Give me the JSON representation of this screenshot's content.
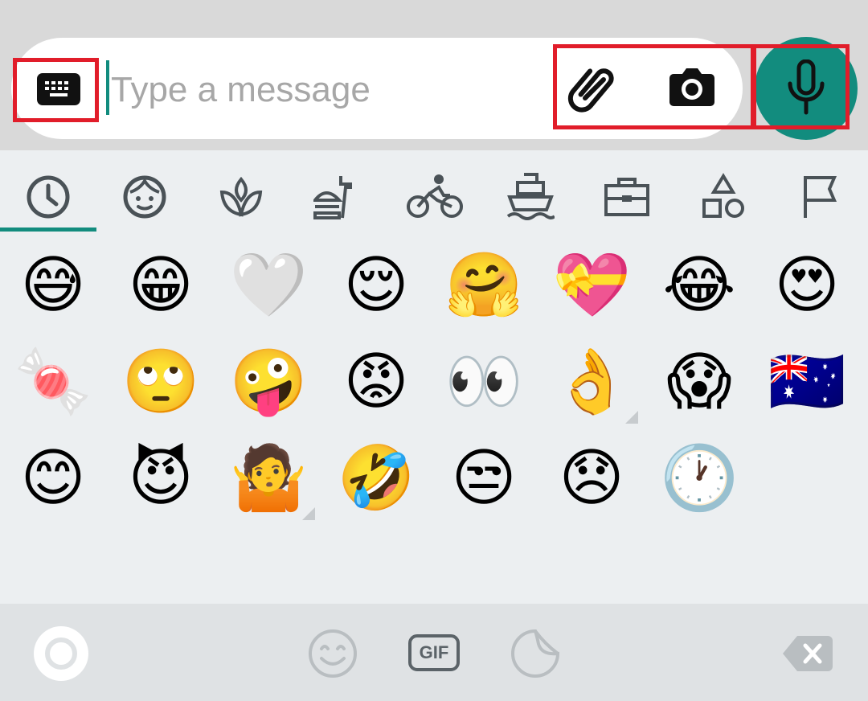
{
  "input": {
    "placeholder": "Type a message",
    "value": "",
    "keyboard_icon": "keyboard-icon",
    "attach_icon": "paperclip-icon",
    "camera_icon": "camera-icon",
    "mic_icon": "microphone-icon"
  },
  "emoji_panel": {
    "categories": [
      {
        "id": "recent",
        "icon": "clock-icon"
      },
      {
        "id": "smileys",
        "icon": "face-icon"
      },
      {
        "id": "nature",
        "icon": "leaf-icon"
      },
      {
        "id": "food",
        "icon": "food-icon"
      },
      {
        "id": "activity",
        "icon": "cyclist-icon"
      },
      {
        "id": "travel",
        "icon": "ship-icon"
      },
      {
        "id": "objects",
        "icon": "briefcase-icon"
      },
      {
        "id": "symbols",
        "icon": "shapes-icon"
      },
      {
        "id": "flags",
        "icon": "flag-icon"
      }
    ],
    "active_category": "recent",
    "recent_emojis": [
      "😅",
      "😁",
      "🤍",
      "😌",
      "🤗",
      "💝",
      "😂",
      "😍",
      "🍬",
      "🙄",
      "🤪",
      "😡",
      "👀",
      "👌",
      "😱",
      "🇦🇺",
      "😊",
      "😈",
      "🤷",
      "🤣",
      "😒",
      "😞",
      "🕐"
    ]
  },
  "bottom_bar": {
    "left_icon": "record-circle-icon",
    "tabs": [
      {
        "id": "emoji",
        "icon": "smiley-icon"
      },
      {
        "id": "gif",
        "label": "GIF",
        "icon": "gif-icon"
      },
      {
        "id": "stickers",
        "icon": "sticker-icon"
      }
    ],
    "backspace_icon": "backspace-icon"
  },
  "colors": {
    "accent": "#128c7e",
    "highlight": "#e11d2a",
    "panel_bg": "#eceff1",
    "icon_gray": "#4a5257"
  }
}
